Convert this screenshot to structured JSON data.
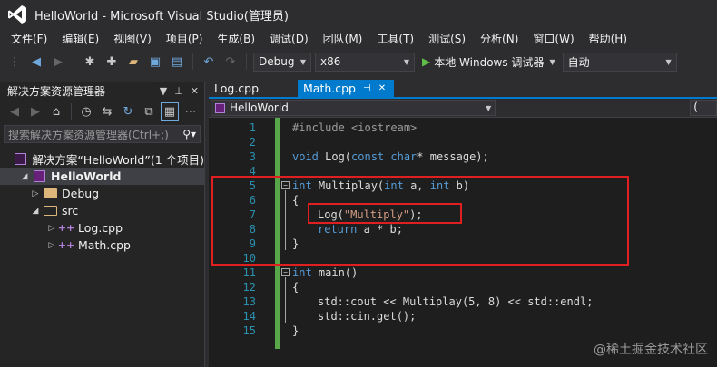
{
  "window": {
    "title": "HelloWorld - Microsoft Visual Studio(管理员)"
  },
  "menu": [
    "文件(F)",
    "编辑(E)",
    "视图(V)",
    "项目(P)",
    "生成(B)",
    "调试(D)",
    "团队(M)",
    "工具(T)",
    "测试(S)",
    "分析(N)",
    "窗口(W)",
    "帮助(H)"
  ],
  "toolbar": {
    "configuration": "Debug",
    "platform": "x86",
    "run_label": "本地 Windows 调试器",
    "run_mode": "自动"
  },
  "solution_explorer": {
    "title": "解决方案资源管理器",
    "search_placeholder": "搜索解决方案资源管理器(Ctrl+;)",
    "tree": [
      {
        "label": "解决方案“HelloWorld”(1 个项目)",
        "type": "solution"
      },
      {
        "label": "HelloWorld",
        "type": "project"
      },
      {
        "label": "Debug",
        "type": "folder"
      },
      {
        "label": "src",
        "type": "folder-open"
      },
      {
        "label": "Log.cpp",
        "type": "cpp"
      },
      {
        "label": "Math.cpp",
        "type": "cpp"
      }
    ]
  },
  "editor": {
    "tabs": [
      {
        "label": "Log.cpp",
        "active": false
      },
      {
        "label": "Math.cpp",
        "active": true
      }
    ],
    "nav_scope": "HelloWorld",
    "nav_scope2": "(",
    "line_numbers": [
      "1",
      "2",
      "3",
      "4",
      "5",
      "6",
      "7",
      "8",
      "9",
      "10",
      "11",
      "12",
      "13",
      "14",
      "15"
    ],
    "code": {
      "l1": "#include <iostream>",
      "l3_a": "void ",
      "l3_b": "Log(",
      "l3_c": "const char",
      "l3_d": "* message);",
      "l5_a": "int",
      "l5_b": " Multiplay(",
      "l5_c": "int",
      "l5_d": " a, ",
      "l5_e": "int",
      "l5_f": " b)",
      "l6": "{",
      "l7_a": "Log(",
      "l7_b": "\"Multiply\"",
      "l7_c": ");",
      "l8_a": "return",
      "l8_b": " a * b;",
      "l9": "}",
      "l11_a": "int",
      "l11_b": " main()",
      "l12": "{",
      "l13": "std::cout << Multiplay(5, 8) << std::endl;",
      "l14": "std::cin.get();",
      "l15": "}"
    }
  },
  "watermark": "@稀土掘金技术社区",
  "colors": {
    "accent": "#007acc",
    "highlight_box": "#e02020",
    "keyword": "#569cd6",
    "string": "#d69d85",
    "line_number": "#2b91af",
    "change_bar": "#57a64a"
  }
}
